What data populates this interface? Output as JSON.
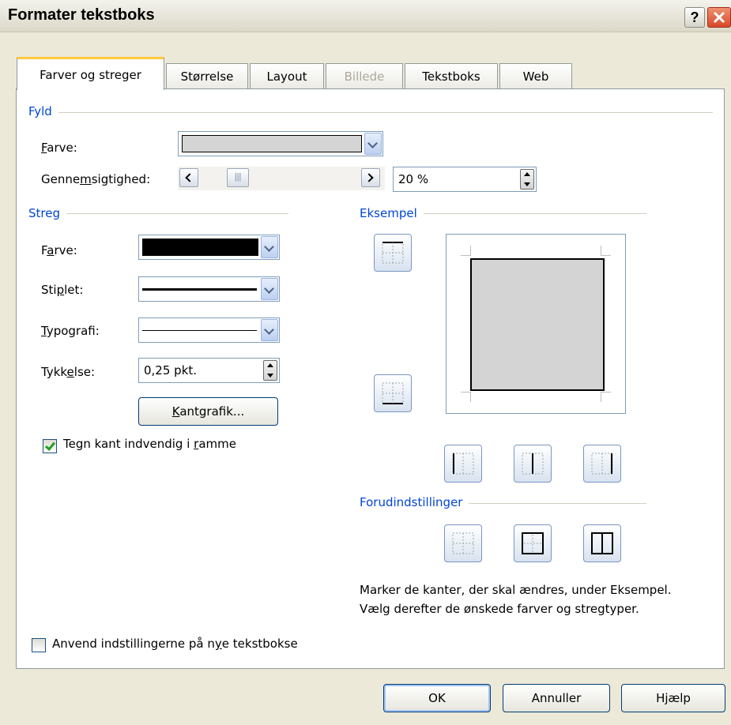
{
  "dialog": {
    "title": "Formater tekstboks",
    "help_glyph": "?",
    "tabs": [
      {
        "label": "Farver og streger",
        "active": true
      },
      {
        "label": "Størrelse"
      },
      {
        "label": "Layout"
      },
      {
        "label": "Billede",
        "disabled": true
      },
      {
        "label": "Tekstboks"
      },
      {
        "label": "Web"
      }
    ]
  },
  "fill": {
    "group_label": "Fyld",
    "color_label_pre": "",
    "color_label_key": "F",
    "color_label_post": "arve:",
    "color_value": "#d4d4d4",
    "transparency_label_pre": "Genne",
    "transparency_label_key": "m",
    "transparency_label_post": "sigtighed:",
    "transparency_value": "20 %",
    "transparency_fraction": 0.2
  },
  "stroke": {
    "group_label": "Streg",
    "color_label_pre": "F",
    "color_label_key": "a",
    "color_label_post": "rve:",
    "color_value": "#000000",
    "dash_label_pre": "Sti",
    "dash_label_key": "p",
    "dash_label_post": "let:",
    "style_label_pre": "",
    "style_label_key": "T",
    "style_label_post": "ypografi:",
    "weight_label_pre": "Tykk",
    "weight_label_key": "e",
    "weight_label_post": "lse:",
    "weight_value": "0,25 pkt.",
    "border_art_pre": "",
    "border_art_key": "K",
    "border_art_post": "antgrafik...",
    "inside_frame_pre": "Tegn kant indvendig i ",
    "inside_frame_key": "r",
    "inside_frame_post": "amme",
    "inside_frame_checked": true
  },
  "preview": {
    "group_label": "Eksempel",
    "presets_label": "Forudindstillinger",
    "hint": "Marker de kanter, der skal ændres, under Eksempel. Vælg derefter de ønskede farver og stregtyper."
  },
  "apply_new": {
    "label_pre": "Anvend indstillingerne på n",
    "label_key": "y",
    "label_post": "e tekstbokse",
    "checked": false
  },
  "footer": {
    "ok_label": "OK",
    "cancel_label": "Annuller",
    "help_label": "Hjælp"
  },
  "colors": {
    "accent_blue": "#0046d5",
    "tab_highlight": "#ffc83c",
    "close_red": "#d8482a"
  }
}
